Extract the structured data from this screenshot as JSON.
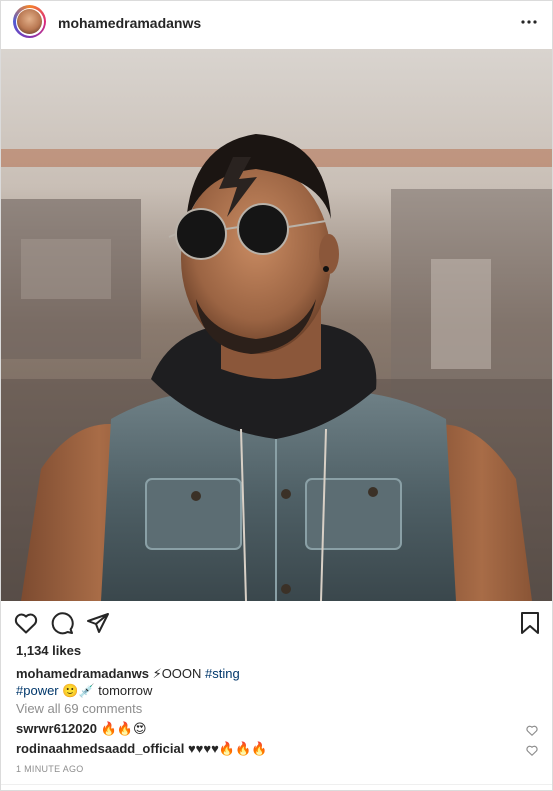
{
  "post": {
    "username": "mohamedramadanws",
    "likes": "1,134 likes",
    "caption": {
      "username": "mohamedramadanws",
      "text_start": "⚡OOON ",
      "hashtag1": "#sting",
      "hashtag2": "#power",
      "text_end": " 🙂💉 tomorrow"
    },
    "view_all_comments": "View all 69 comments",
    "comments": [
      {
        "username": "swrwr612020",
        "text": "🔥🔥😍"
      },
      {
        "username": "rodinaahmedsaadd_official",
        "text": "♥♥♥♥🔥🔥🔥"
      }
    ],
    "timestamp": "1 MINUTE AGO"
  },
  "icons": {
    "more": "more-options-icon",
    "like": "heart-icon",
    "comment": "comment-icon",
    "share": "share-icon",
    "save": "bookmark-icon"
  },
  "colors": {
    "text": "#262626",
    "muted": "#8e8e8e",
    "hashtag": "#00376b",
    "border": "#dbdbdb"
  }
}
